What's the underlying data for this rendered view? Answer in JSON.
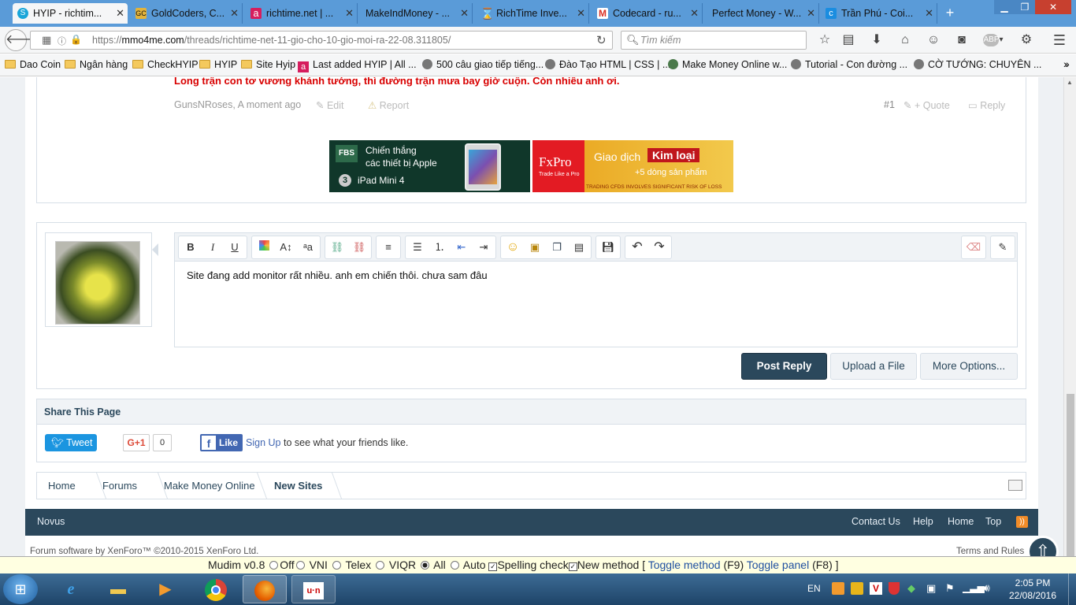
{
  "browser": {
    "tabs": [
      {
        "label": "HYIP - richtim...",
        "favicon_color": "#1aa6d9",
        "active": true
      },
      {
        "label": "GoldCoders, C...",
        "favicon_color": "#e2b33b",
        "active": false
      },
      {
        "label": "richtime.net | ...",
        "favicon_color": "#d61e5e",
        "active": false
      },
      {
        "label": "MakeIndMoney - ...",
        "favicon_color": "",
        "active": false
      },
      {
        "label": "RichTime Inve...",
        "favicon_color": "#1a6b45",
        "active": false
      },
      {
        "label": "Codecard - ru...",
        "favicon_color": "#d93025",
        "active": false
      },
      {
        "label": "Perfect Money - W...",
        "favicon_color": "",
        "active": false
      },
      {
        "label": "Trần Phú - Coi...",
        "favicon_color": "#1a8de0",
        "active": false
      }
    ],
    "new_tab_label": "+",
    "url_prefix": "https://",
    "url_domain": "mmo4me.com",
    "url_path": "/threads/richtime-net-11-gio-cho-10-gio-moi-ra-22-08.311805/",
    "search_placeholder": "Tìm kiếm",
    "bookmarks": [
      {
        "label": "Dao Coin",
        "icon": "folder-icon"
      },
      {
        "label": "Ngân hàng",
        "icon": "folder-icon"
      },
      {
        "label": "CheckHYIP",
        "icon": "folder-icon"
      },
      {
        "label": "HYIP",
        "icon": "folder-icon"
      },
      {
        "label": "Site Hyip",
        "icon": "folder-icon"
      },
      {
        "label": "Last added HYIP | All ...",
        "icon": "favicon-a"
      },
      {
        "label": "500 câu giao tiếp tiếng...",
        "icon": "globe-icon"
      },
      {
        "label": "Đào Tạo HTML | CSS | ...",
        "icon": "globe-icon"
      },
      {
        "label": "Make Money Online w...",
        "icon": "globe-icon"
      },
      {
        "label": "Tutorial - Con đường ...",
        "icon": "globe-icon"
      },
      {
        "label": "CỜ TƯỚNG: CHUYÊN ...",
        "icon": "globe-icon"
      }
    ]
  },
  "post": {
    "text": "Long trận con tơ vương khánh tướng, thì đường trận mưa bay giờ cuộn. Còn nhiều anh ơi.",
    "author": "GunsNRoses",
    "time": "A moment ago",
    "edit_label": "Edit",
    "report_label": "Report",
    "number": "#1",
    "quote_label": "+ Quote",
    "reply_label": "Reply"
  },
  "ads": {
    "fbs": {
      "brand": "FBS",
      "line1": "Chiến thắng",
      "line2": "các thiết bị Apple",
      "badge": "3",
      "product": "iPad Mini 4"
    },
    "fxpro": {
      "brand": "FxPro",
      "tagline": "Trade Like a Pro",
      "headline": "Giao dịch",
      "highlight": "Kim loại",
      "sub": "+5 dòng sản phẩm",
      "disclaimer": "TRADING CFDS INVOLVES SIGNIFICANT RISK OF LOSS"
    }
  },
  "editor": {
    "content": "Site đang add monitor rất nhiều. anh em chiến thôi. chưa sam đâu",
    "post_reply": "Post Reply",
    "upload": "Upload a File",
    "more": "More Options..."
  },
  "share": {
    "title": "Share This Page",
    "tweet": "Tweet",
    "gplus": "G+1",
    "gplus_count": "0",
    "like": "Like",
    "signup": "Sign Up",
    "signup_suffix": "to see what your friends like."
  },
  "breadcrumb": [
    "Home",
    "Forums",
    "Make Money Online",
    "New Sites"
  ],
  "footer": {
    "style": "Novus",
    "links": [
      "Contact Us",
      "Help",
      "Home",
      "Top"
    ],
    "copyright": "Forum software by XenForo™ ©2010-2015 XenForo Ltd.",
    "terms": "Terms and Rules"
  },
  "mudim": {
    "version": "Mudim v0.8",
    "options": [
      "Off",
      "VNI",
      "Telex",
      "VIQR",
      "All",
      "Auto"
    ],
    "selected": "All",
    "spelling": "Spelling check",
    "new_method": "New method",
    "toggle_method": "Toggle method",
    "toggle_method_key": "(F9)",
    "toggle_panel": "Toggle panel",
    "toggle_panel_key": "(F8)"
  },
  "taskbar": {
    "lang": "EN",
    "time": "2:05 PM",
    "date": "22/08/2016"
  }
}
